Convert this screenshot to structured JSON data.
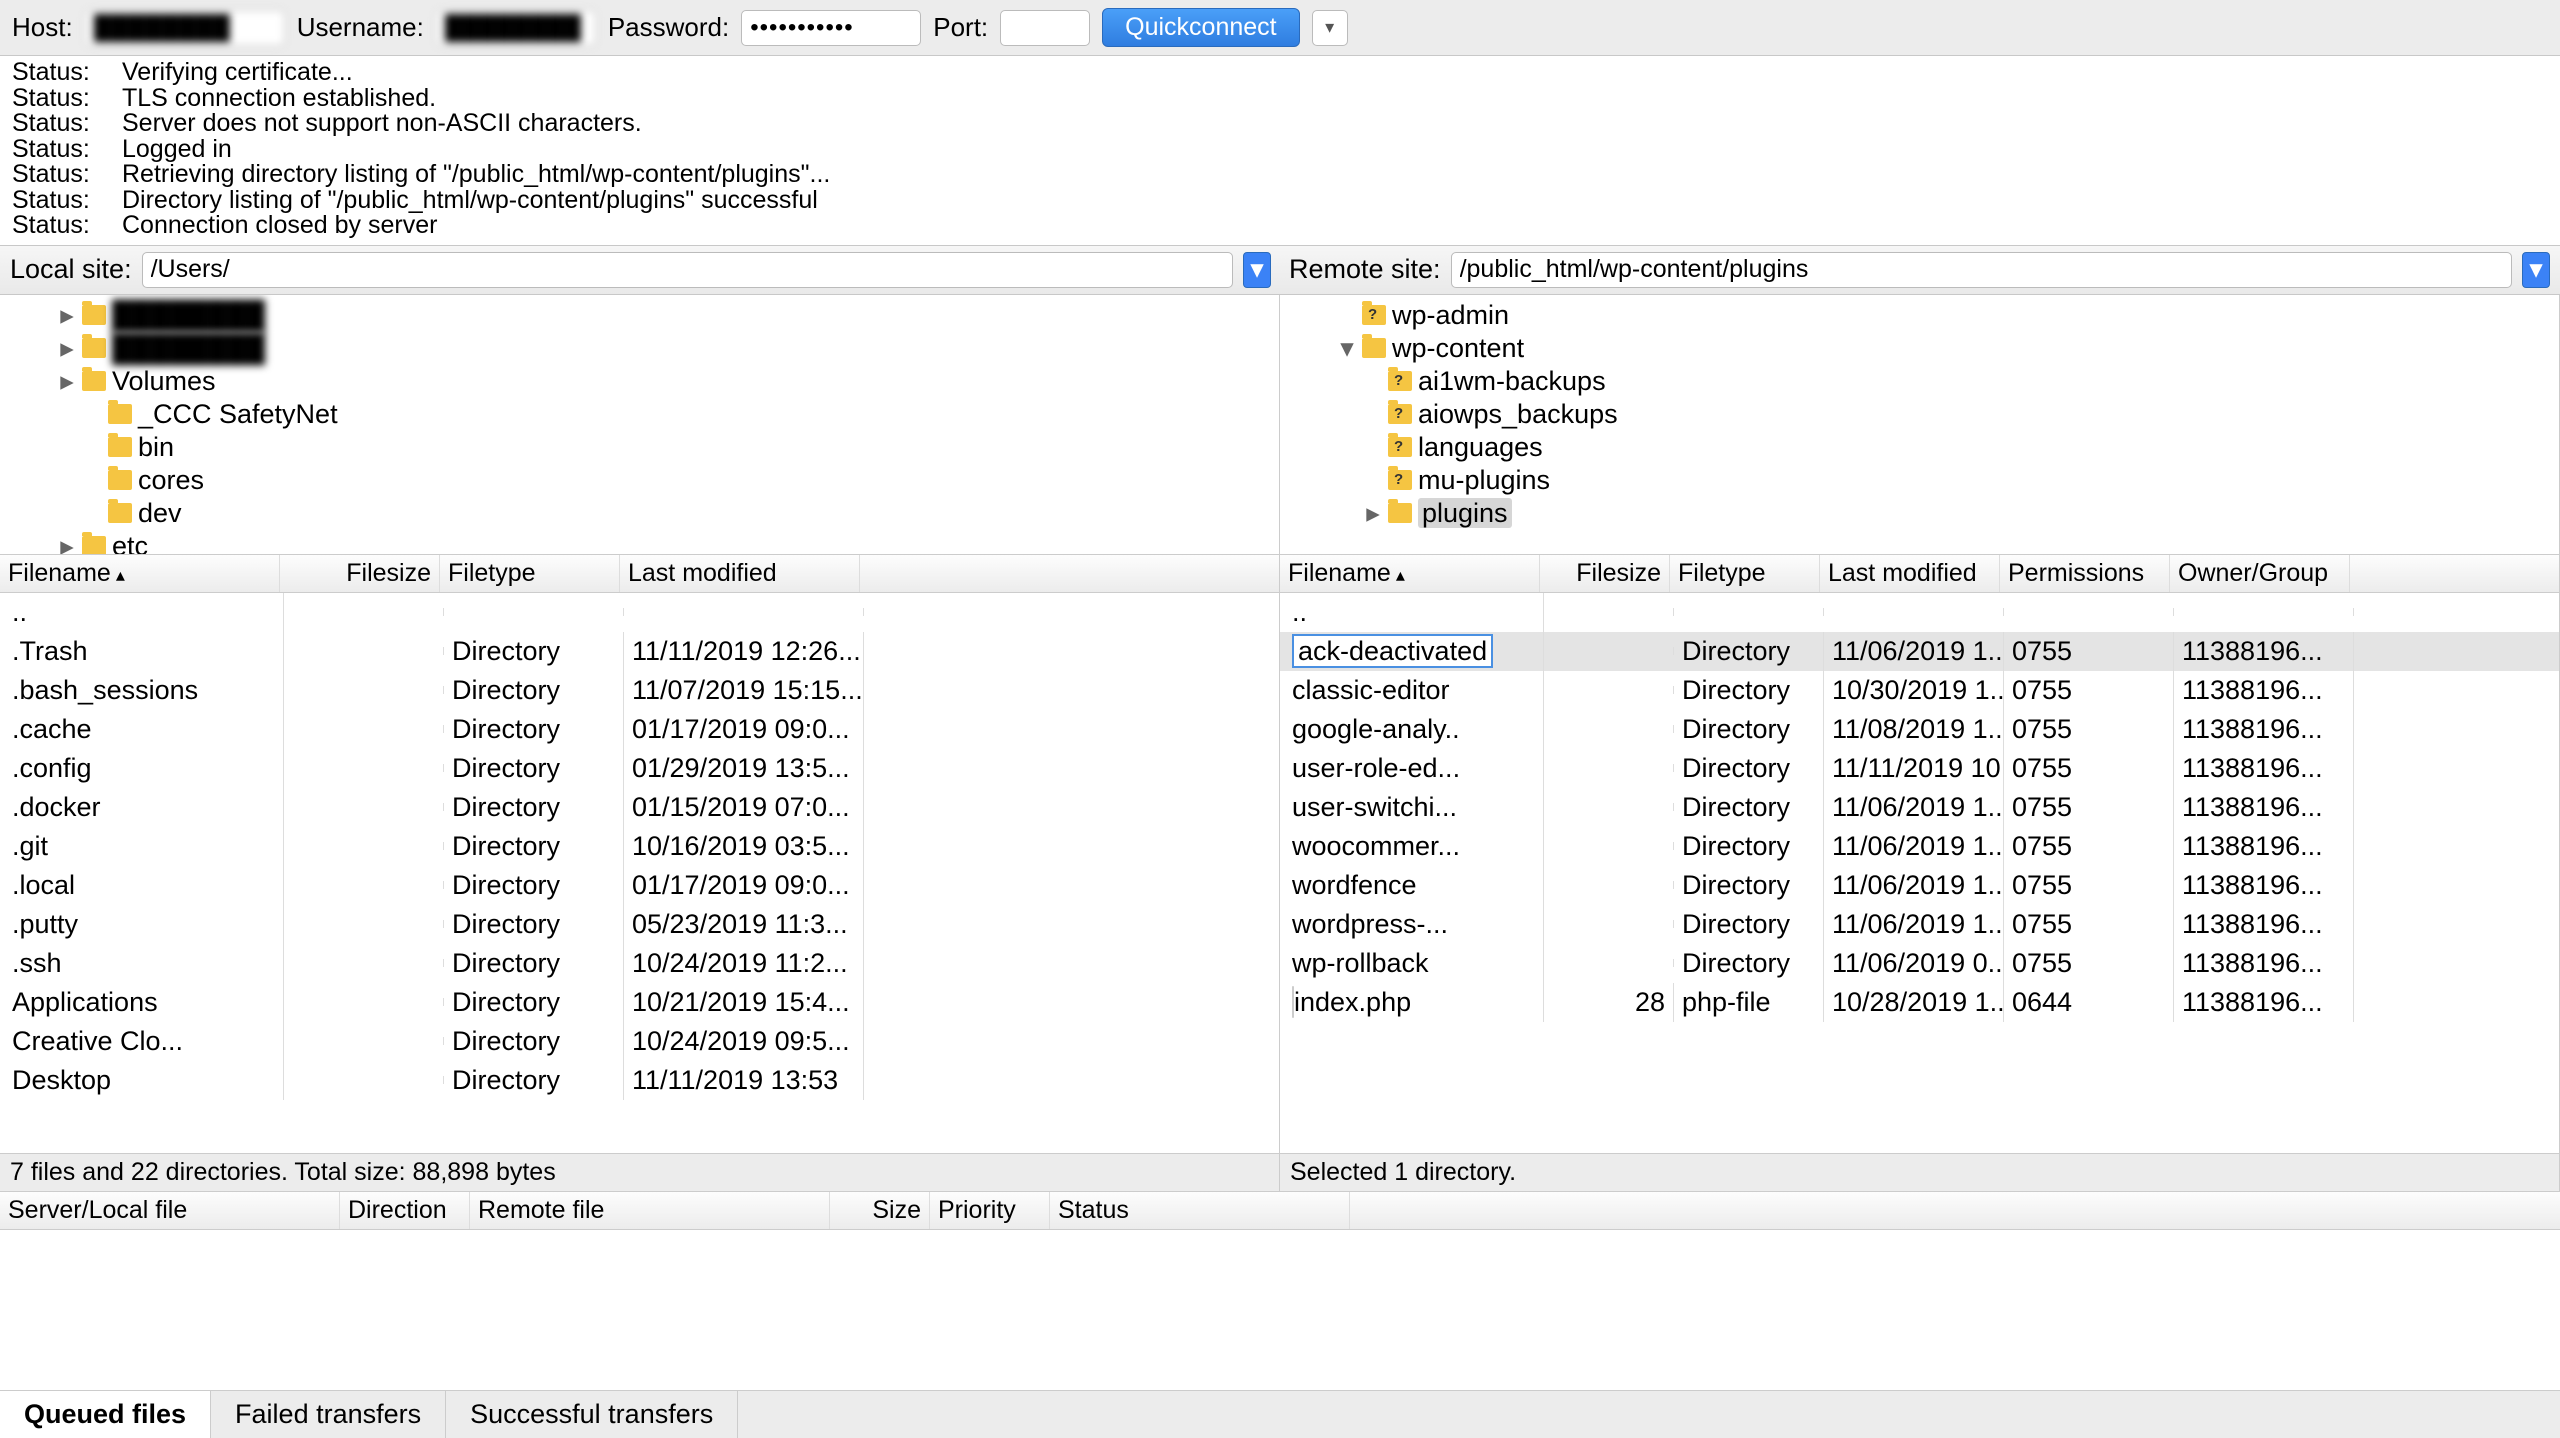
{
  "toolbar": {
    "host_label": "Host:",
    "host_value": "████████",
    "user_label": "Username:",
    "user_value": "████████",
    "pass_label": "Password:",
    "pass_value": "●●●●●●●●●●●",
    "port_label": "Port:",
    "port_value": "",
    "quick_label": "Quickconnect"
  },
  "log": [
    {
      "label": "Status:",
      "msg": "Verifying certificate..."
    },
    {
      "label": "Status:",
      "msg": "TLS connection established."
    },
    {
      "label": "Status:",
      "msg": "Server does not support non-ASCII characters."
    },
    {
      "label": "Status:",
      "msg": "Logged in"
    },
    {
      "label": "Status:",
      "msg": "Retrieving directory listing of \"/public_html/wp-content/plugins\"..."
    },
    {
      "label": "Status:",
      "msg": "Directory listing of \"/public_html/wp-content/plugins\" successful"
    },
    {
      "label": "Status:",
      "msg": "Connection closed by server"
    }
  ],
  "sites": {
    "local_label": "Local site:",
    "local_path": "/Users/",
    "remote_label": "Remote site:",
    "remote_path": "/public_html/wp-content/plugins"
  },
  "local_tree": [
    {
      "indent": 2,
      "exp": "▸",
      "blur": true,
      "name": "████████"
    },
    {
      "indent": 2,
      "exp": "▸",
      "blur": true,
      "name": "████████"
    },
    {
      "indent": 2,
      "exp": "▸",
      "name": "Volumes"
    },
    {
      "indent": 3,
      "exp": " ",
      "name": "_CCC SafetyNet"
    },
    {
      "indent": 3,
      "exp": " ",
      "name": "bin"
    },
    {
      "indent": 3,
      "exp": " ",
      "name": "cores"
    },
    {
      "indent": 3,
      "exp": " ",
      "name": "dev"
    },
    {
      "indent": 2,
      "exp": "▸",
      "name": "etc"
    }
  ],
  "remote_tree": [
    {
      "indent": 2,
      "exp": " ",
      "q": true,
      "name": "wp-admin"
    },
    {
      "indent": 2,
      "exp": "▾",
      "name": "wp-content"
    },
    {
      "indent": 3,
      "exp": " ",
      "q": true,
      "name": "ai1wm-backups"
    },
    {
      "indent": 3,
      "exp": " ",
      "q": true,
      "name": "aiowps_backups"
    },
    {
      "indent": 3,
      "exp": " ",
      "q": true,
      "name": "languages"
    },
    {
      "indent": 3,
      "exp": " ",
      "q": true,
      "name": "mu-plugins"
    },
    {
      "indent": 3,
      "exp": "▸",
      "sel": true,
      "name": "plugins"
    }
  ],
  "local_cols": {
    "filename": "Filename",
    "filesize": "Filesize",
    "filetype": "Filetype",
    "lastmod": "Last modified"
  },
  "local_files": [
    {
      "name": "..",
      "size": "",
      "type": "",
      "mod": ""
    },
    {
      "name": ".Trash",
      "size": "",
      "type": "Directory",
      "mod": "11/11/2019 12:26..."
    },
    {
      "name": ".bash_sessions",
      "size": "",
      "type": "Directory",
      "mod": "11/07/2019 15:15..."
    },
    {
      "name": ".cache",
      "size": "",
      "type": "Directory",
      "mod": "01/17/2019 09:0..."
    },
    {
      "name": ".config",
      "size": "",
      "type": "Directory",
      "mod": "01/29/2019 13:5..."
    },
    {
      "name": ".docker",
      "size": "",
      "type": "Directory",
      "mod": "01/15/2019 07:0..."
    },
    {
      "name": ".git",
      "size": "",
      "type": "Directory",
      "mod": "10/16/2019 03:5..."
    },
    {
      "name": ".local",
      "size": "",
      "type": "Directory",
      "mod": "01/17/2019 09:0..."
    },
    {
      "name": ".putty",
      "size": "",
      "type": "Directory",
      "mod": "05/23/2019 11:3..."
    },
    {
      "name": ".ssh",
      "size": "",
      "type": "Directory",
      "mod": "10/24/2019 11:2..."
    },
    {
      "name": "Applications",
      "size": "",
      "type": "Directory",
      "mod": "10/21/2019 15:4..."
    },
    {
      "name": "Creative Clo...",
      "size": "",
      "type": "Directory",
      "mod": "10/24/2019 09:5..."
    },
    {
      "name": "Desktop",
      "size": "",
      "type": "Directory",
      "mod": "11/11/2019 13:53"
    }
  ],
  "local_status": "7 files and 22 directories. Total size: 88,898 bytes",
  "remote_cols": {
    "filename": "Filename",
    "filesize": "Filesize",
    "filetype": "Filetype",
    "lastmod": "Last modified",
    "perm": "Permissions",
    "owner": "Owner/Group"
  },
  "remote_files": [
    {
      "name": "..",
      "size": "",
      "type": "",
      "mod": "",
      "perm": "",
      "owner": ""
    },
    {
      "name": "ack-deactivated",
      "size": "",
      "type": "Directory",
      "mod": "11/06/2019 1...",
      "perm": "0755",
      "owner": "11388196...",
      "rename": true,
      "selected": true
    },
    {
      "name": "classic-editor",
      "size": "",
      "type": "Directory",
      "mod": "10/30/2019 1...",
      "perm": "0755",
      "owner": "11388196..."
    },
    {
      "name": "google-analy..",
      "size": "",
      "type": "Directory",
      "mod": "11/08/2019 1...",
      "perm": "0755",
      "owner": "11388196..."
    },
    {
      "name": "user-role-ed...",
      "size": "",
      "type": "Directory",
      "mod": "11/11/2019 10...",
      "perm": "0755",
      "owner": "11388196..."
    },
    {
      "name": "user-switchi...",
      "size": "",
      "type": "Directory",
      "mod": "11/06/2019 1...",
      "perm": "0755",
      "owner": "11388196..."
    },
    {
      "name": "woocommer...",
      "size": "",
      "type": "Directory",
      "mod": "11/06/2019 1...",
      "perm": "0755",
      "owner": "11388196..."
    },
    {
      "name": "wordfence",
      "size": "",
      "type": "Directory",
      "mod": "11/06/2019 1...",
      "perm": "0755",
      "owner": "11388196..."
    },
    {
      "name": "wordpress-...",
      "size": "",
      "type": "Directory",
      "mod": "11/06/2019 1...",
      "perm": "0755",
      "owner": "11388196..."
    },
    {
      "name": "wp-rollback",
      "size": "",
      "type": "Directory",
      "mod": "11/06/2019 0...",
      "perm": "0755",
      "owner": "11388196..."
    },
    {
      "name": "index.php",
      "size": "28",
      "type": "php-file",
      "mod": "10/28/2019 1...",
      "perm": "0644",
      "owner": "11388196...",
      "isFile": true
    }
  ],
  "remote_status": "Selected 1 directory.",
  "queue_cols": {
    "server": "Server/Local file",
    "dir": "Direction",
    "remote": "Remote file",
    "size": "Size",
    "prio": "Priority",
    "status": "Status"
  },
  "tabs": {
    "queued": "Queued files",
    "failed": "Failed transfers",
    "success": "Successful transfers"
  }
}
